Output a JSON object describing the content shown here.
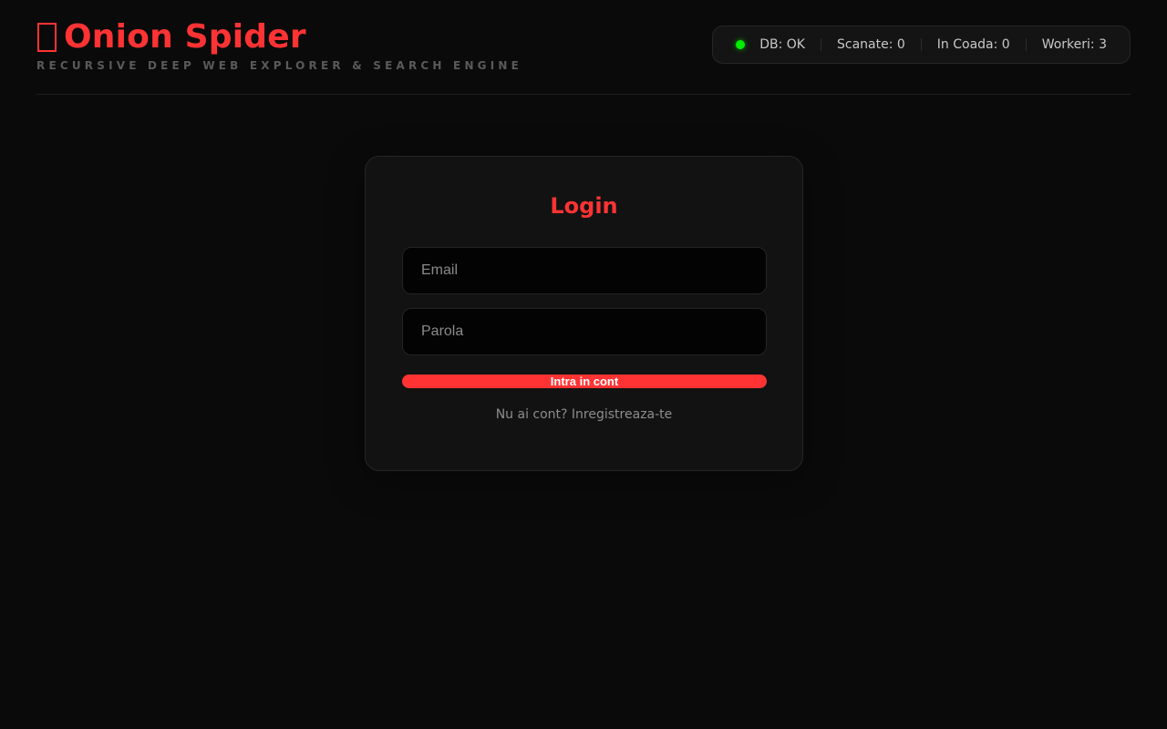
{
  "header": {
    "icon": "spider-icon",
    "title": "Onion Spider",
    "subtitle": "RECURSIVE DEEP WEB EXPLORER & SEARCH ENGINE"
  },
  "status": {
    "db": "DB: OK",
    "scanned": "Scanate: 0",
    "queue": "In Coada: 0",
    "workers": "Workeri: 3",
    "ok_color": "#00ee00"
  },
  "login": {
    "title": "Login",
    "email_placeholder": "Email",
    "password_placeholder": "Parola",
    "submit_label": "Intra in cont",
    "register_label": "Nu ai cont? Inregistreaza-te"
  },
  "theme": {
    "background": "#0a0a0a",
    "card": "#121212",
    "accent": "#ff3333"
  }
}
